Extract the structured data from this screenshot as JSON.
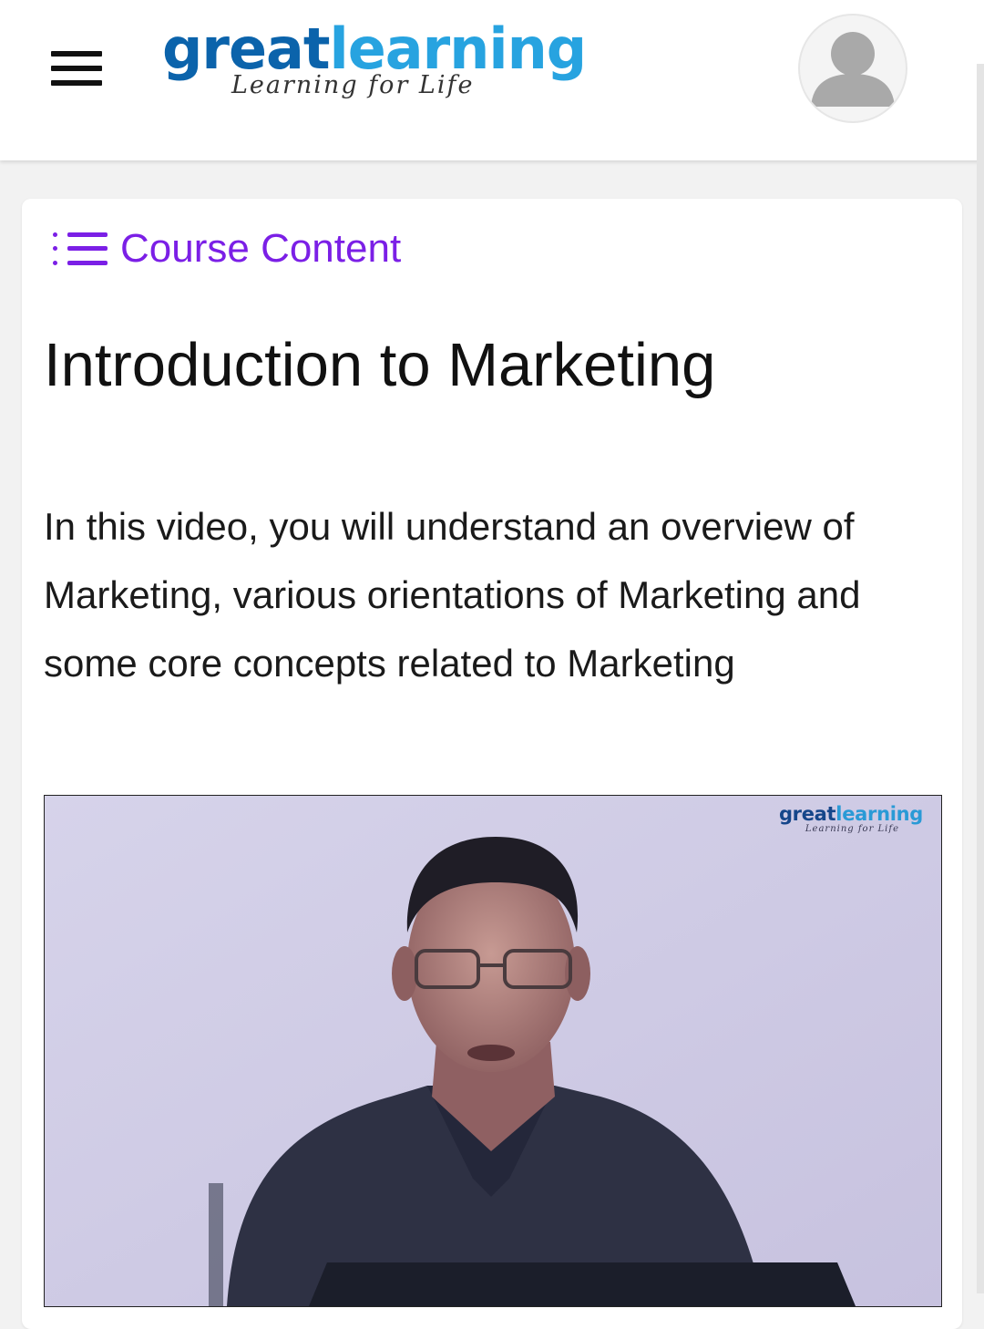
{
  "header": {
    "menu_icon": "hamburger-menu-icon",
    "logo": {
      "brand_part1": "great",
      "brand_part2": "learning",
      "tagline": "Learning for Life",
      "colors": {
        "great": "#0b63ab",
        "learning": "#27a3e0"
      }
    },
    "avatar_icon": "user-avatar-icon"
  },
  "content": {
    "course_content_icon": "list-icon",
    "course_content_label": "Course Content",
    "accent_color": "#7b1fe6",
    "lesson_title": "Introduction to Marketing",
    "lesson_description": "In this video, you will understand an overview of Marketing, various orientations of Marketing and some core concepts related to Marketing"
  },
  "video": {
    "watermark_part1": "great",
    "watermark_part2": "learning",
    "watermark_tagline": "Learning for Life"
  }
}
